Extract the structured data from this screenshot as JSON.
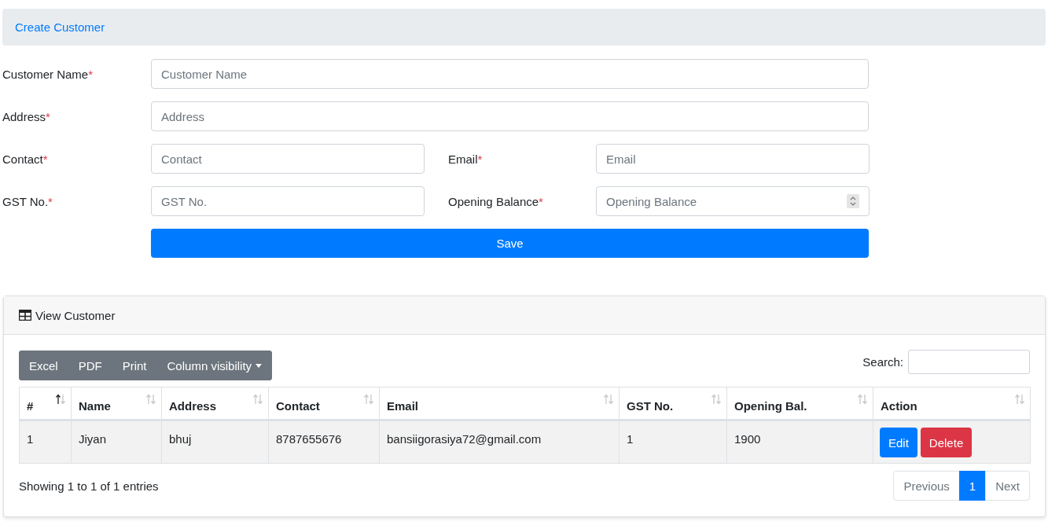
{
  "form": {
    "title": "Create Customer",
    "rows": [
      [
        {
          "label": "Customer Name",
          "required_mark": "*",
          "placeholder": "Customer Name",
          "kind": "text"
        }
      ],
      [
        {
          "label": "Address",
          "required_mark": "*",
          "placeholder": "Address",
          "kind": "text"
        }
      ],
      [
        {
          "label": "Contact",
          "required_mark": "*",
          "placeholder": "Contact",
          "kind": "text"
        },
        {
          "label": "Email",
          "required_mark": "*",
          "placeholder": "Email",
          "kind": "text"
        }
      ],
      [
        {
          "label": "GST No.",
          "required_mark": "*",
          "placeholder": "GST No.",
          "kind": "text"
        },
        {
          "label": "Opening Balance",
          "required_mark": "*",
          "placeholder": "Opening Balance",
          "kind": "number"
        }
      ]
    ],
    "submit": "Save"
  },
  "table_card": {
    "title": "View Customer",
    "export_buttons": [
      {
        "label": "Excel",
        "kind": "plain"
      },
      {
        "label": "PDF",
        "kind": "plain"
      },
      {
        "label": "Print",
        "kind": "plain"
      },
      {
        "label": "Column visibility",
        "kind": "dropdown"
      }
    ],
    "search": {
      "label": "Search:"
    },
    "columns": [
      {
        "label": "#",
        "sorted": true
      },
      {
        "label": "Name",
        "sorted": false
      },
      {
        "label": "Address",
        "sorted": false
      },
      {
        "label": "Contact",
        "sorted": false
      },
      {
        "label": "Email",
        "sorted": false
      },
      {
        "label": "GST No.",
        "sorted": false
      },
      {
        "label": "Opening Bal.",
        "sorted": false
      },
      {
        "label": "Action",
        "sorted": false
      }
    ],
    "rows": [
      {
        "cells": [
          "1",
          "Jiyan",
          "bhuj",
          "8787655676",
          "bansiigorasiya72@gmail.com",
          "1",
          "1900"
        ],
        "actions": [
          {
            "label": "Edit",
            "kind": "primary"
          },
          {
            "label": "Delete",
            "kind": "danger"
          }
        ]
      }
    ],
    "info": "Showing 1 to 1 of 1 entries",
    "pagination": [
      {
        "label": "Previous",
        "selected": false
      },
      {
        "label": "1",
        "selected": true
      },
      {
        "label": "Next",
        "selected": false
      }
    ]
  }
}
